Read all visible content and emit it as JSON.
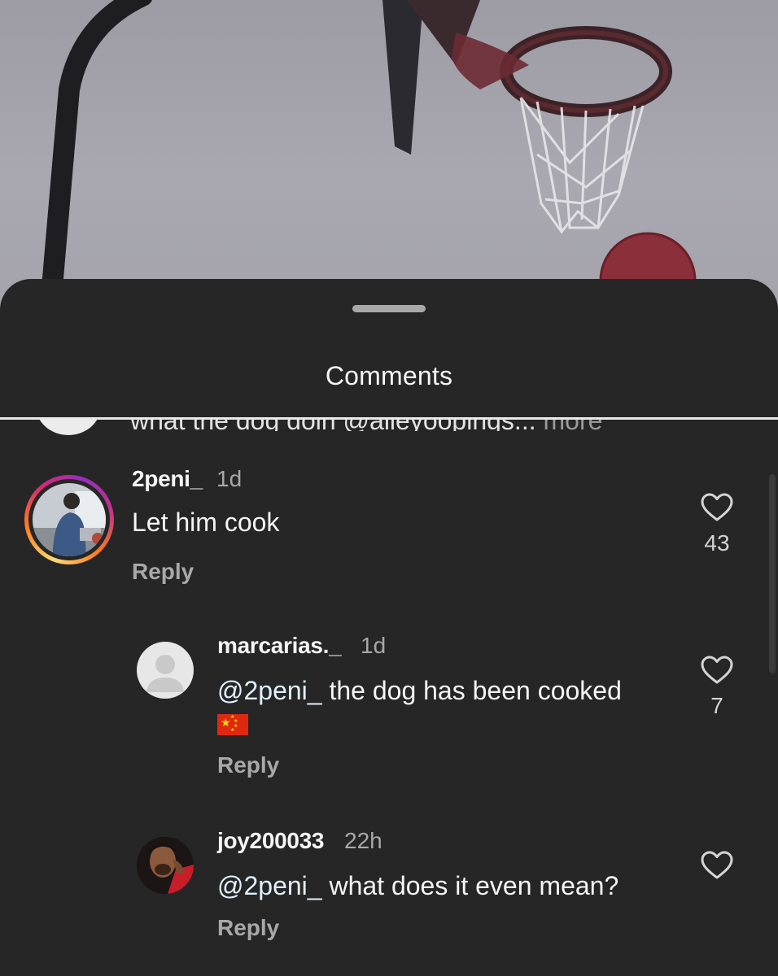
{
  "video": {
    "description_icon": "basketball-hoop"
  },
  "sheet": {
    "title": "Comments"
  },
  "previous_comment": {
    "text": "what the dog doin @alleyoopings...",
    "more": "more"
  },
  "comments": [
    {
      "username": "2peni_",
      "time": "1d",
      "text": "Let him cook",
      "reply_label": "Reply",
      "likes": "43",
      "avatar_ring": true
    },
    {
      "username": "marcarias._",
      "time": "1d",
      "mention": "@2peni_",
      "text": " the dog has been cooked",
      "emoji": "flag-china",
      "reply_label": "Reply",
      "likes": "7"
    },
    {
      "username": "joy200033",
      "time": "22h",
      "mention": "@2peni_",
      "text": " what does it even mean?",
      "reply_label": "Reply",
      "likes": ""
    }
  ],
  "colors": {
    "sheet_bg": "#262626",
    "text_primary": "#f5f5f5",
    "text_secondary": "#a8a8a8",
    "mention": "#e0f1ff",
    "story_ring_start": "#feda75",
    "story_ring_end": "#d62976"
  }
}
